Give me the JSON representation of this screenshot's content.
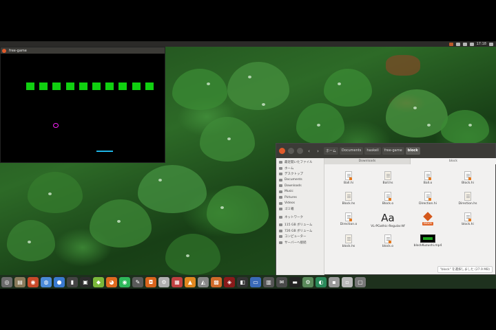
{
  "top_panel": {
    "clock": "17:18"
  },
  "game_window": {
    "title": "free-game",
    "block_count": 10,
    "colors": {
      "block": "#10d010",
      "ball": "#ff22ff",
      "paddle": "#1fb6e8"
    }
  },
  "file_manager": {
    "breadcrumbs": [
      "ホーム",
      "Documents",
      "haskell",
      "free-game",
      "block"
    ],
    "tabs": [
      "Downloads",
      "block"
    ],
    "sidebar": [
      "最近開いたファイル",
      "ホーム",
      "デスクトップ",
      "Documents",
      "Downloads",
      "Music",
      "Pictures",
      "Videos",
      "ゴミ箱",
      "ネットワーク",
      "115 GB ボリューム",
      "726 GB ボリューム",
      "コンピューター",
      "サーバーへ接続"
    ],
    "files": [
      {
        "name": "Ball.hi",
        "type": "hi"
      },
      {
        "name": "Ball.hs",
        "type": "hs"
      },
      {
        "name": "Ball.o",
        "type": "o"
      },
      {
        "name": "Block.hi",
        "type": "hi"
      },
      {
        "name": "Block.hs",
        "type": "hs"
      },
      {
        "name": "Block.o",
        "type": "o"
      },
      {
        "name": "Direction.hi",
        "type": "hi"
      },
      {
        "name": "Direction.hs",
        "type": "hs"
      },
      {
        "name": "Direction.o",
        "type": "o"
      },
      {
        "name": "VL-PGothic-Regular.ttf",
        "type": "font",
        "glyph": "Aa"
      },
      {
        "name": "block",
        "type": "exe",
        "selected": true
      },
      {
        "name": "block.hi",
        "type": "hi"
      },
      {
        "name": "block.hs",
        "type": "hs"
      },
      {
        "name": "block.o",
        "type": "o"
      },
      {
        "name": "blockKuzushi.mp4",
        "type": "video"
      }
    ],
    "status": "\"block\" を選択しました (27.9 MB)"
  },
  "dock": {
    "icons": [
      "dash-icon",
      "files-icon",
      "browser-icon",
      "chrome-icon",
      "chromium-icon",
      "terminal-icon",
      "clion-icon",
      "android-icon",
      "firefox-icon",
      "line-icon",
      "text-editor-icon",
      "store-icon",
      "settings-icon",
      "office-icon",
      "vlc-icon",
      "unity-icon",
      "photos-icon",
      "wine-icon",
      "camera-icon",
      "monitor-icon",
      "network-icon",
      "mail-icon",
      "console-icon",
      "gear-icon",
      "globe-icon",
      "drive-icon",
      "disk-icon",
      "trash-icon"
    ]
  }
}
